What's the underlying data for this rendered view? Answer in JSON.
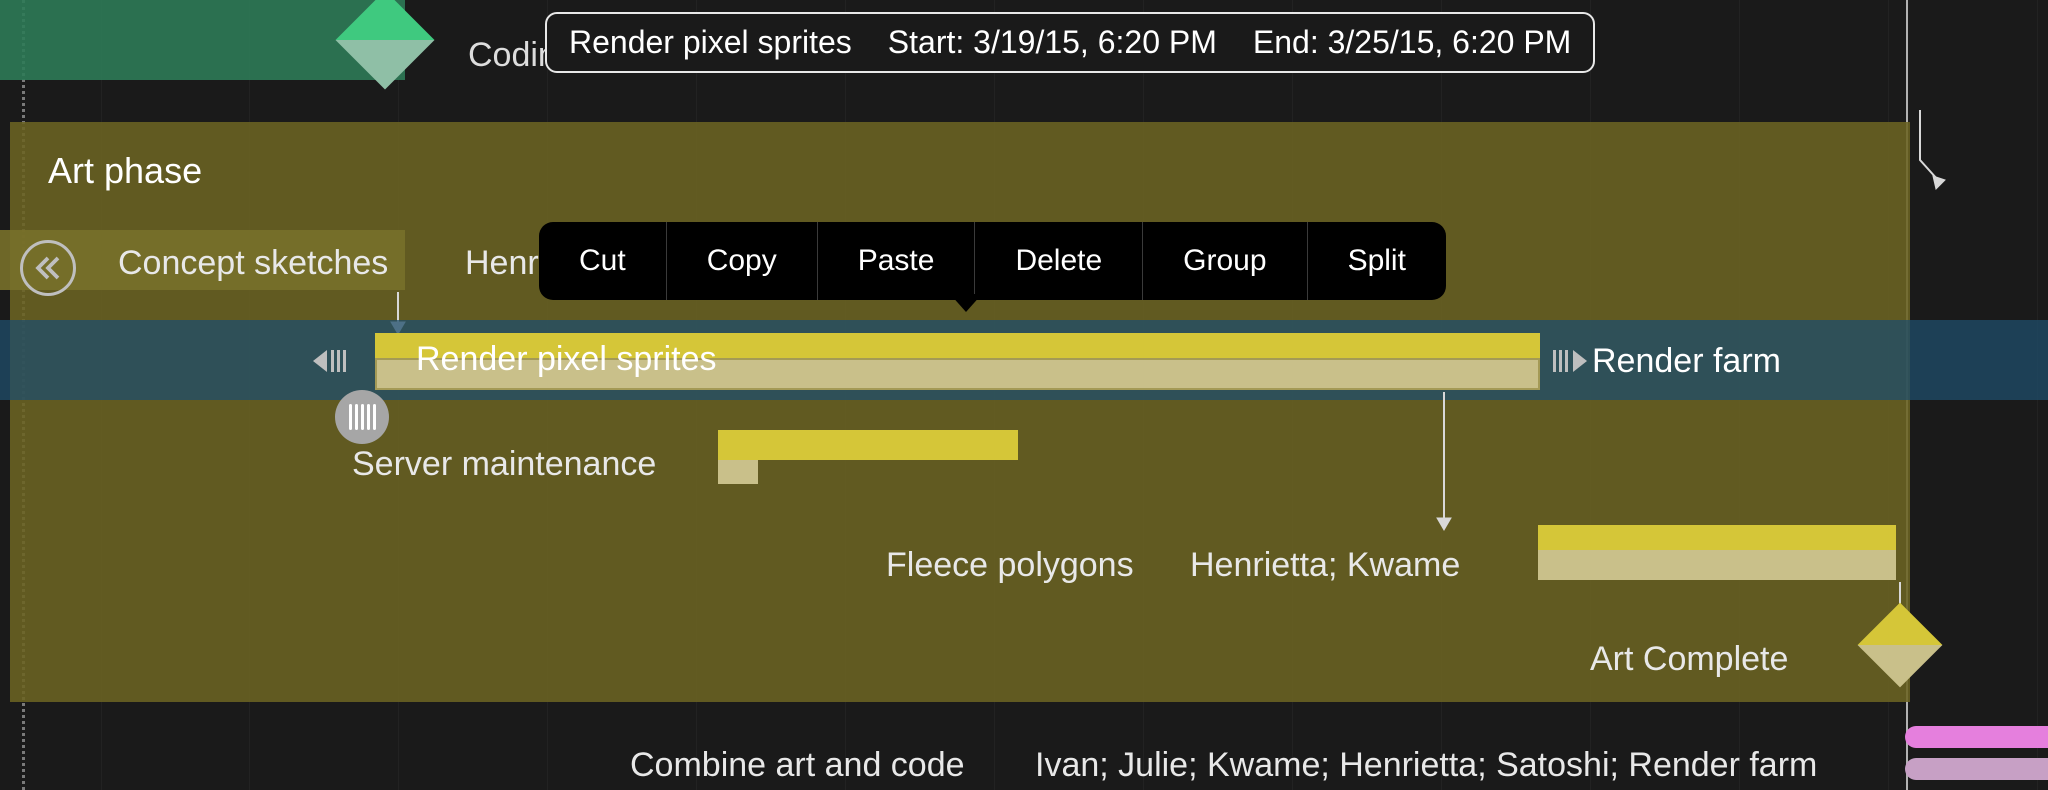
{
  "tooltip": {
    "title": "Render pixel sprites",
    "start": "Start: 3/19/15, 6:20 PM",
    "end": "End: 3/25/15, 6:20 PM"
  },
  "milestones": {
    "coding_complete": "Coding Complete",
    "art_complete": "Art Complete"
  },
  "phases": {
    "art": "Art phase"
  },
  "tasks": {
    "concept_sketches": {
      "label": "Concept sketches",
      "resources": "Henrietta; Kwame"
    },
    "render_pixel_sprites": {
      "label": "Render pixel sprites",
      "resources": "Render farm"
    },
    "server_maintenance": {
      "label": "Server maintenance"
    },
    "fleece_polygons": {
      "label": "Fleece polygons",
      "resources": "Henrietta; Kwame"
    },
    "combine": {
      "label": "Combine art and code",
      "resources": "Ivan; Julie; Kwame; Henrietta; Satoshi; Render farm"
    }
  },
  "context_menu": {
    "cut": "Cut",
    "copy": "Copy",
    "paste": "Paste",
    "delete": "Delete",
    "group": "Group",
    "split": "Split"
  },
  "colors": {
    "accent_yellow": "#d5c638",
    "accent_green": "#3fc97f",
    "accent_pink": "#e57fdd",
    "selection": "#1f4d6b"
  }
}
